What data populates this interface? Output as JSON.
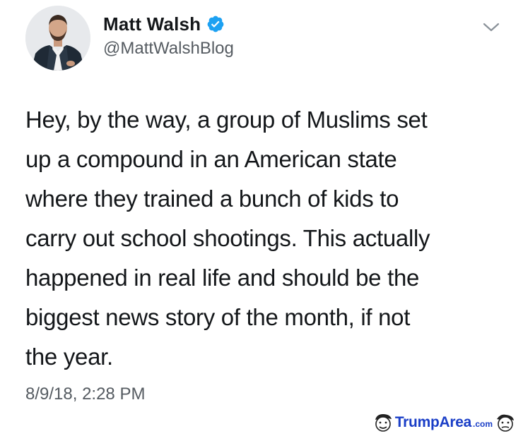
{
  "tweet": {
    "display_name": "Matt Walsh",
    "handle": "@MattWalshBlog",
    "text_lines": [
      "Hey, by the way, a group of Muslims set",
      "up a compound in an American state",
      "where they trained a bunch of kids to",
      "carry out school shootings. This actually",
      "happened in real life and should be the",
      "biggest news story of the month, if not",
      "the year."
    ],
    "timestamp": "8/9/18, 2:28 PM",
    "verified_color": "#1da1f2",
    "icons": {
      "avatar": "profile-photo",
      "verified": "verified-badge-icon",
      "menu": "chevron-down-icon"
    }
  },
  "watermark": {
    "brand_first": "Trump",
    "brand_second": "Area",
    "suffix": ".com",
    "color": "#1a3ec7"
  }
}
